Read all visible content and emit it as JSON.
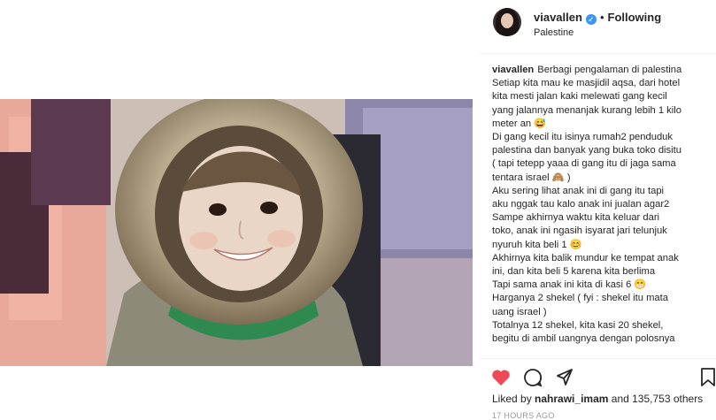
{
  "post": {
    "username": "viavallen",
    "follow_status": "Following",
    "separator": "•",
    "location": "Palestine",
    "caption_lines": [
      "Berbagi pengalaman di palestina",
      "Setiap kita mau ke masjidil aqsa, dari hotel",
      "kita mesti jalan kaki melewati gang kecil",
      "yang jalannya menanjak kurang lebih 1 kilo",
      "meter an 😅",
      "Di gang kecil itu isinya rumah2 penduduk",
      "palestina dan banyak yang buka toko disitu",
      "( tapi tetepp yaaa di gang itu di jaga sama",
      "tentara israel 🙈 )",
      "Aku sering lihat anak ini di gang itu tapi",
      "aku nggak tau kalo anak ini jualan agar2",
      "Sampe akhirnya waktu kita keluar dari",
      "toko, anak ini ngasih isyarat jari telunjuk",
      "nyuruh kita beli 1 😊",
      "Akhirnya kita balik mundur ke tempat anak",
      "ini, dan kita beli 5 karena kita berlima",
      "Tapi sama anak ini kita di kasi 6 😁",
      "Harganya 2 shekel ( fyi : shekel itu mata",
      "uang israel )",
      "Totalnya 12 shekel, kita kasi 20 shekel,",
      "begitu di ambil uangnya dengan polosnya"
    ],
    "liked_by_prefix": "Liked by",
    "liked_by_user": "nahrawi_imam",
    "liked_by_suffix": "and 135,753 others",
    "time": "17 HOURS AGO"
  },
  "icons": {
    "like": "heart-icon",
    "comment": "comment-icon",
    "share": "share-icon",
    "save": "bookmark-icon",
    "verified": "verified-badge-icon"
  },
  "colors": {
    "like": "#ed4956",
    "verified": "#3897f0",
    "muted": "#999999",
    "text": "#262626"
  }
}
